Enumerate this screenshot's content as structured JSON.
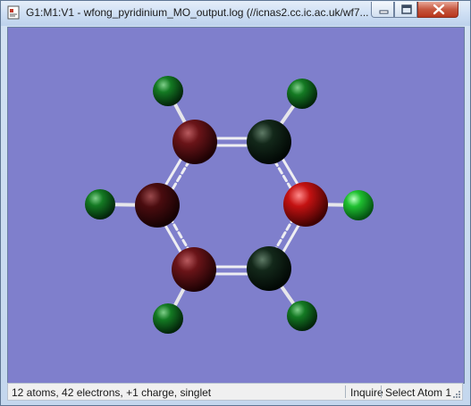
{
  "window": {
    "title": "G1:M1:V1 - wfong_pyridinium_MO_output.log (//icnas2.cc.ic.ac.uk/wf7...",
    "app_icon": "gaussview-document-icon",
    "buttons": [
      "minimize-icon",
      "maximize-icon",
      "close-icon"
    ]
  },
  "viewport": {
    "background_color": "#7f7fcc",
    "molecule": {
      "atoms": [
        {
          "element": "C",
          "color": "#5a0e12"
        },
        {
          "element": "C",
          "color": "#3d0a0c"
        },
        {
          "element": "C",
          "color": "#5a0e12"
        },
        {
          "element": "C",
          "color": "#0c2010"
        },
        {
          "element": "N",
          "color": "#b01010"
        },
        {
          "element": "C",
          "color": "#0c2010"
        },
        {
          "element": "H",
          "color": "#0f6b1c"
        },
        {
          "element": "H",
          "color": "#0f6b1c"
        },
        {
          "element": "H",
          "color": "#0f6b1c"
        },
        {
          "element": "H",
          "color": "#0f6b1c"
        },
        {
          "element": "H",
          "color": "#13a323"
        },
        {
          "element": "H",
          "color": "#0f6b1c"
        }
      ]
    }
  },
  "statusbar": {
    "summary": "12 atoms, 42 electrons, +1 charge, singlet",
    "mode": "Inquire",
    "action": "Select Atom 1"
  }
}
